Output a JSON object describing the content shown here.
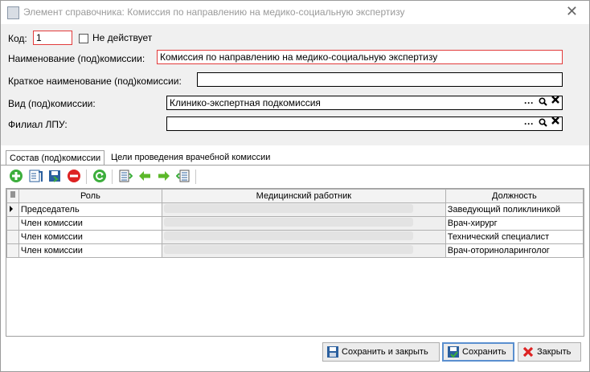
{
  "window": {
    "title": "Элемент справочника: Комиссия по направлению на медико-социальную экспертизу"
  },
  "form": {
    "code_label": "Код:",
    "code_value": "1",
    "inactive_label": "Не действует",
    "name_label": "Наименование (под)комиссии:",
    "name_value": "Комиссия по направлению на медико-социальную экспертизу",
    "short_label": "Краткое наименование (под)комиссии:",
    "short_value": "",
    "type_label": "Вид (под)комиссии:",
    "type_value": "Клинико-экспертная подкомиссия",
    "branch_label": "Филиал ЛПУ:",
    "branch_value": "",
    "picker_dots": "···"
  },
  "tabs": [
    {
      "label": "Состав (под)комиссии"
    },
    {
      "label": "Цели проведения врачебной комиссии"
    }
  ],
  "toolbar": [
    {
      "icon": "add-icon"
    },
    {
      "icon": "edit-icon"
    },
    {
      "icon": "save-icon"
    },
    {
      "icon": "delete-icon"
    },
    {
      "icon": "refresh-icon"
    },
    {
      "icon": "list-icon"
    },
    {
      "icon": "arrow-left-icon"
    },
    {
      "icon": "arrow-right-icon"
    },
    {
      "icon": "list2-icon"
    }
  ],
  "grid": {
    "headers": [
      "Роль",
      "Медицинский работник",
      "Должность"
    ],
    "rows": [
      {
        "role": "Председатель",
        "position": "Заведующий поликлиникой"
      },
      {
        "role": "Член комиссии",
        "position": "Врач-хирург"
      },
      {
        "role": "Член комиссии",
        "position": "Технический специалист"
      },
      {
        "role": "Член комиссии",
        "position": "Врач-оториноларинголог"
      }
    ]
  },
  "buttons": {
    "save_close": "Сохранить и закрыть",
    "save": "Сохранить",
    "close": "Закрыть"
  }
}
